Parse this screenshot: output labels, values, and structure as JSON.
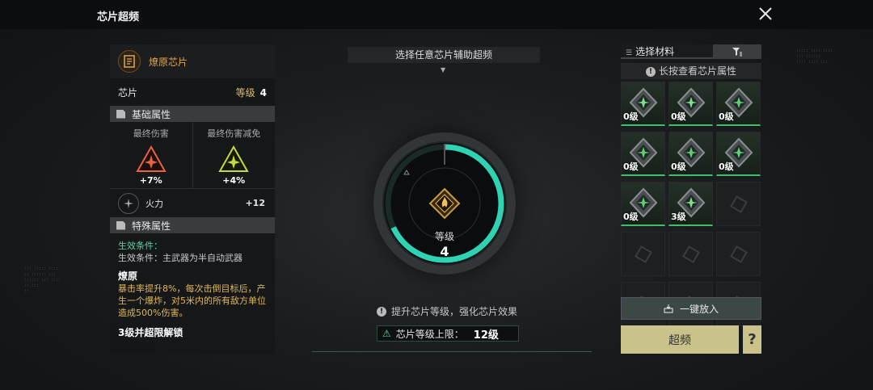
{
  "header": {
    "title": "芯片超频"
  },
  "chip": {
    "name": "燎原芯片",
    "label": "芯片",
    "level_label": "等级",
    "level_value": "4"
  },
  "basic": {
    "title": "基础属性",
    "attrs": [
      {
        "label": "最终伤害",
        "value": "+7%",
        "color": "#e8643a"
      },
      {
        "label": "最终伤害减免",
        "value": "+4%",
        "color": "#c6d93a"
      }
    ],
    "firepower": {
      "label": "火力",
      "value": "+12"
    }
  },
  "special": {
    "title": "特殊属性",
    "cond_title": "生效条件：",
    "cond_text": "生效条件：主武器为半自动武器",
    "name": "燎原",
    "desc": "暴击率提升8%，每次击倒目标后，产生一个爆炸，对5米内的所有敌方单位造成500%伤害。",
    "unlock": "3级并超限解锁"
  },
  "center": {
    "choose": "选择任意芯片辅助超频",
    "level_label": "等级",
    "level_value": "4",
    "progress": 0.68,
    "hint": "提升芯片等级，强化芯片效果",
    "limit_label": "芯片等级上限：",
    "limit_value": "12级"
  },
  "right": {
    "tab_label": "选择材料",
    "longpress": "长按查看芯片属性",
    "items": [
      {
        "level": "0级",
        "filled": true,
        "kind": "green"
      },
      {
        "level": "0级",
        "filled": true,
        "kind": "green"
      },
      {
        "level": "0级",
        "filled": true,
        "kind": "gray"
      },
      {
        "level": "0级",
        "filled": true,
        "kind": "gray"
      },
      {
        "level": "0级",
        "filled": true,
        "kind": "gray"
      },
      {
        "level": "0级",
        "filled": true,
        "kind": "gray"
      },
      {
        "level": "0级",
        "filled": true,
        "kind": "gray"
      },
      {
        "level": "3级",
        "filled": true,
        "kind": "green"
      },
      {
        "level": "",
        "filled": false
      },
      {
        "level": "",
        "filled": false
      },
      {
        "level": "",
        "filled": false
      },
      {
        "level": "",
        "filled": false
      },
      {
        "level": "",
        "filled": false
      },
      {
        "level": "",
        "filled": false
      },
      {
        "level": "",
        "filled": false
      }
    ],
    "one_put": "一键放入",
    "overclock": "超频",
    "help": "?"
  },
  "colors": {
    "accent": "#2ed3b4",
    "gold": "#c9c28a",
    "orange": "#e0a64c"
  }
}
